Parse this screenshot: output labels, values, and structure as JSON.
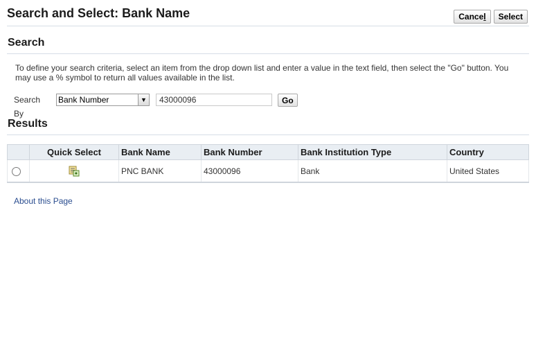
{
  "page": {
    "title": "Search and Select: Bank Name",
    "cancel_label_pre": "Cance",
    "cancel_label_accel": "l",
    "select_label": "Select"
  },
  "search": {
    "section_title": "Search",
    "instructions": "To define your search criteria, select an item from the drop down list and enter a value in the text field, then select the \"Go\" button. You may use a % symbol to return all values available in the list.",
    "search_by_label": "Search By",
    "search_by_value": "Bank Number",
    "search_value": "43000096",
    "go_label": "Go"
  },
  "results": {
    "section_title": "Results",
    "columns": [
      "Quick Select",
      "Bank Name",
      "Bank Number",
      "Bank Institution Type",
      "Country"
    ],
    "rows": [
      {
        "bank_name": "PNC BANK",
        "bank_number": "43000096",
        "institution_type": "Bank",
        "country": "United States",
        "quick_select_icon": "quick-select-icon"
      }
    ]
  },
  "footer": {
    "about_link": "About this Page"
  }
}
